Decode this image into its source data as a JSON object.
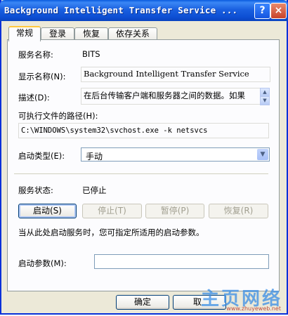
{
  "window": {
    "title": "Background Intelligent Transfer Service ...",
    "help": "?",
    "close": "×"
  },
  "tabs": [
    "常规",
    "登录",
    "恢复",
    "依存关系"
  ],
  "fields": {
    "service_name_label": "服务名称:",
    "service_name": "BITS",
    "display_name_label": "显示名称(N):",
    "display_name": "Background Intelligent Transfer Service",
    "description_label": "描述(D):",
    "description": "在后台传输客户端和服务器之间的数据。如果",
    "exe_path_label": "可执行文件的路径(H):",
    "exe_path": "C:\\WINDOWS\\system32\\svchost.exe -k netsvcs",
    "startup_type_label": "启动类型(E):",
    "startup_type": "手动"
  },
  "status": {
    "label": "服务状态:",
    "value": "已停止"
  },
  "buttons": {
    "start": "启动(S)",
    "stop": "停止(T)",
    "pause": "暂停(P)",
    "resume": "恢复(R)"
  },
  "hint": "当从此处启动服务时，您可指定所适用的启动参数。",
  "params": {
    "label": "启动参数(M):",
    "value": ""
  },
  "footer": {
    "ok": "确定",
    "cancel_partial": "取"
  },
  "watermark": {
    "text": "主页网络",
    "sub": "www.zhuyeweb.net"
  }
}
